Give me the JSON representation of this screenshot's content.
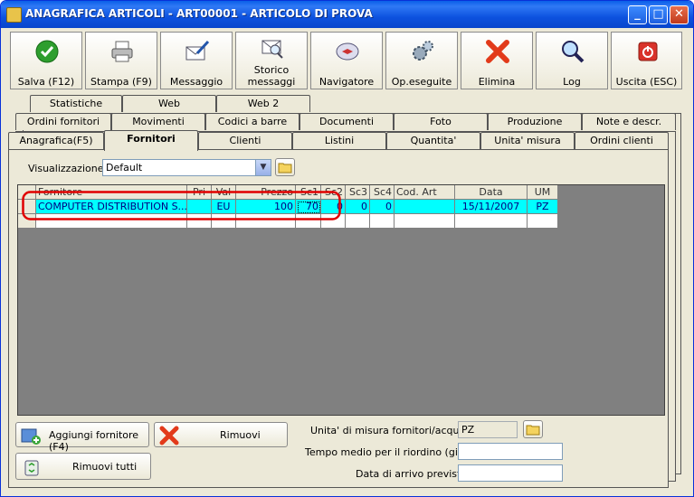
{
  "window": {
    "title": "ANAGRAFICA ARTICOLI - ART00001 - ARTICOLO DI PROVA",
    "minimize_glyph": "_",
    "maximize_glyph": "□",
    "close_glyph": "✕"
  },
  "toolbar": [
    {
      "name": "salva",
      "label": "Salva (F12)",
      "icon": "check-icon"
    },
    {
      "name": "stampa",
      "label": "Stampa (F9)",
      "icon": "printer-icon"
    },
    {
      "name": "messaggio",
      "label": "Messaggio",
      "icon": "envelope-pen-icon"
    },
    {
      "name": "storico",
      "label_line1": "Storico",
      "label_line2": "messaggi",
      "icon": "envelope-search-icon"
    },
    {
      "name": "navigatore",
      "label": "Navigatore",
      "icon": "compass-icon"
    },
    {
      "name": "opeseguite",
      "label": "Op.eseguite",
      "icon": "gears-icon"
    },
    {
      "name": "elimina",
      "label": "Elimina",
      "icon": "delete-x-icon"
    },
    {
      "name": "log",
      "label": "Log",
      "icon": "magnifier-icon"
    },
    {
      "name": "uscita",
      "label": "Uscita (ESC)",
      "icon": "power-icon"
    }
  ],
  "tabs": {
    "row1": [
      "Statistiche",
      "Web",
      "Web 2"
    ],
    "row2": [
      "Ordini fornitori",
      "Movimenti",
      "Codici a barre",
      "Documenti",
      "Foto",
      "Produzione",
      "Note e descr."
    ],
    "row3": [
      "Anagrafica(F5)",
      "Fornitori",
      "Clienti",
      "Listini",
      "Quantita'",
      "Unita' misura",
      "Ordini clienti"
    ],
    "active": "Fornitori"
  },
  "visualizzazione": {
    "label": "Visualizzazione :",
    "value": "Default"
  },
  "grid": {
    "columns": [
      "Fornitore",
      "Pri",
      "Val",
      "Prezzo",
      "Sc1",
      "Sc2",
      "Sc3",
      "Sc4",
      "Cod. Art",
      "Data",
      "UM"
    ],
    "rows": [
      [
        "COMPUTER DISTRIBUTION S...",
        "",
        "EU",
        "100",
        "70",
        "0",
        "0",
        "0",
        "",
        "15/11/2007",
        "PZ"
      ]
    ],
    "highlight_color": "#00FFFF",
    "annotation_color": "#E00000"
  },
  "buttons": {
    "aggiungi": "Aggiungi fornitore (F4)",
    "rimuovi": "Rimuovi",
    "rimuovi_tutti": "Rimuovi tutti"
  },
  "form": {
    "um_label": "Unita' di misura fornitori/acquisto :",
    "um_value": "PZ",
    "tempo_label": "Tempo medio per il riordino (giorni) :",
    "tempo_value": "",
    "data_label": "Data di arrivo prevista :",
    "data_value": ""
  }
}
